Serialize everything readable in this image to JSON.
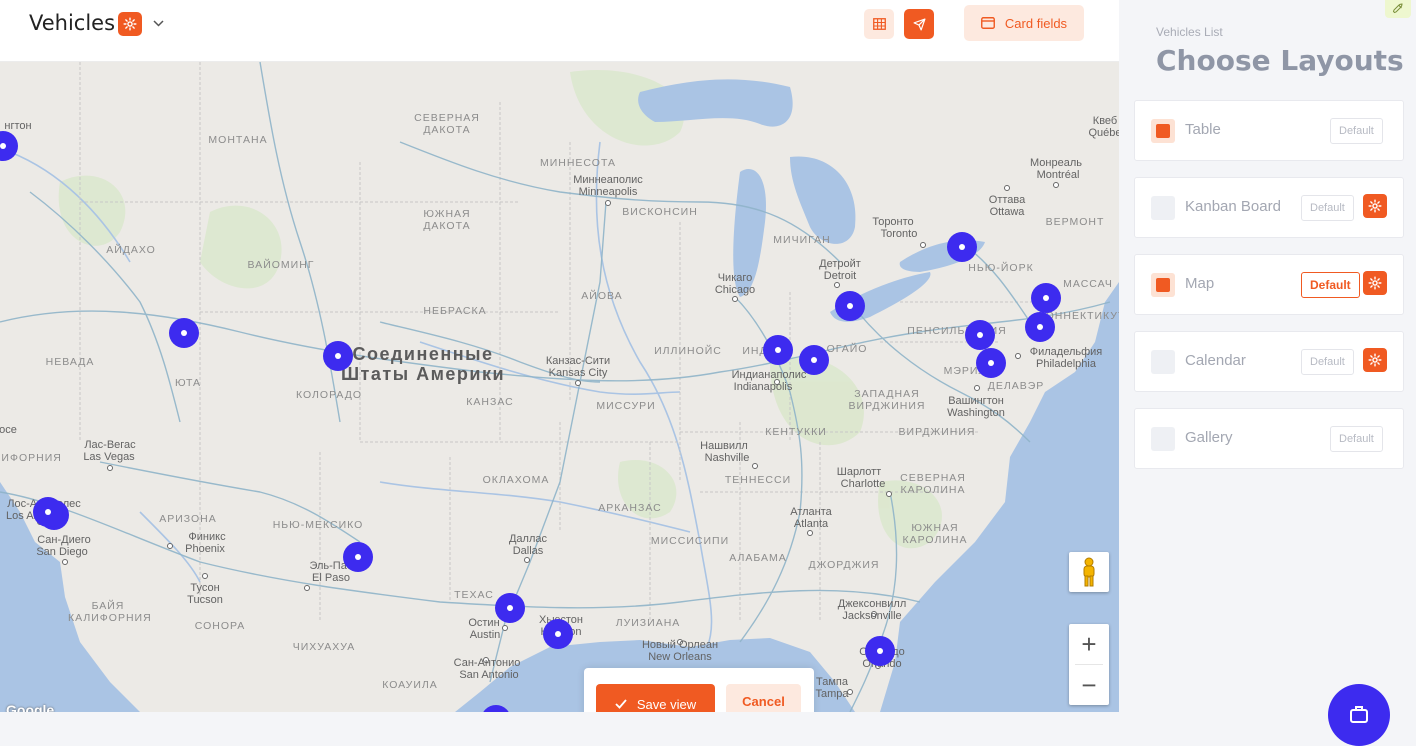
{
  "header": {
    "title": "Vehicles",
    "card_fields_label": "Card fields",
    "icons": [
      "gear-icon",
      "chevron-down-icon",
      "table-icon",
      "send-icon",
      "card-icon"
    ]
  },
  "colors": {
    "accent": "#f05a22",
    "accent_light": "#fde9df",
    "marker": "#3d2bef"
  },
  "map": {
    "country_label": [
      "Соединенные",
      "Штаты Америки"
    ],
    "state_labels": [
      "МОНТАНА",
      "СЕВЕРНАЯ ДАКОТА",
      "ЮЖНАЯ ДАКОТА",
      "АЙДАХО",
      "ВАЙОМИНГ",
      "НЕБРАСКА",
      "НЕВАДА",
      "ЮТА",
      "КОЛОРАДО",
      "КАНЗАС",
      "МИССУРИ",
      "АЙОВА",
      "ИЛЛИНОЙС",
      "ИНД",
      "ОГАЙО",
      "МИННЕСОТА",
      "ВИСКОНСИН",
      "МИЧИГАН",
      "ОКЛАХОМА",
      "АРИЗОНА",
      "НЬЮ-МЕКСИКО",
      "ТЕХАС",
      "АРКАНЗАС",
      "ТЕННЕССИ",
      "КЕНТУККИ",
      "МИССИСИПИ",
      "АЛАБАМА",
      "ДЖОРДЖИЯ",
      "ЮЖНАЯ КАРОЛИНА",
      "СЕВЕРНАЯ КАРОЛИНА",
      "ВИРДЖИНИЯ",
      "ЗАПАДНАЯ ВИРДЖИНИЯ",
      "ПЕНСИЛЬВАНИЯ",
      "НЬЮ-ЙОРК",
      "ВЕРМОНТ",
      "МАССАЧ",
      "КОННЕКТИКУТ",
      "ДЕЛАВЭР",
      "МЭРИЛ",
      "ЛУИЗИАНА",
      "СОНОРА",
      "ЧИХУАХУА",
      "КОАУИЛА",
      "БАЙЯ КАЛИФОРНИЯ",
      "КАЛИФОРНИЯ"
    ],
    "city_labels": [
      "Миннеаполис",
      "Minneapolis",
      "Торонто",
      "Toronto",
      "Оттава",
      "Ottawa",
      "Монреаль",
      "Montréal",
      "Квеб",
      "Québe",
      "Детройт",
      "Detroit",
      "Чикаго",
      "Chicago",
      "Канзас-Сити",
      "Kansas City",
      "Индианаполис",
      "Indianapolis",
      "Филадельфия",
      "Philadelphia",
      "Вашингтон",
      "Washington",
      "Нашвилл",
      "Nashville",
      "Шарлотт",
      "Charlotte",
      "Атланта",
      "Atlanta",
      "Даллас",
      "Dallas",
      "Остин",
      "Austin",
      "Хьюстон",
      "Houston",
      "Сан-Антонио",
      "San Antonio",
      "Эль-Пасо",
      "El Paso",
      "Финикс",
      "Phoenix",
      "Тусон",
      "Tucson",
      "Лас-Вегас",
      "Las Vegas",
      "Лос-Анджелес",
      "Los Angeles",
      "Сан-Диего",
      "San Diego",
      "Новый Орлеан",
      "New Orleans",
      "Джексонвилл",
      "Jacksonville",
      "Орландо",
      "Orlando",
      "Тампа",
      "Tampa",
      "нгтон",
      "осе",
      "ифорния"
    ],
    "google_label": "Google",
    "controls": [
      "pegman-icon",
      "zoom-in-icon",
      "zoom-out-icon"
    ],
    "zoom_in": "+",
    "zoom_out": "−",
    "marker_count": 18
  },
  "save_bar": {
    "save_label": "Save view",
    "cancel_label": "Cancel"
  },
  "sidebar": {
    "subtitle": "Vehicles List",
    "title": "Choose Layouts",
    "layouts": [
      {
        "name": "Table",
        "default_label": "Default",
        "checked": true,
        "is_default": false,
        "has_settings": false
      },
      {
        "name": "Kanban Board",
        "default_label": "Default",
        "checked": false,
        "is_default": false,
        "has_settings": true
      },
      {
        "name": "Map",
        "default_label": "Default",
        "checked": true,
        "is_default": true,
        "has_settings": true
      },
      {
        "name": "Calendar",
        "default_label": "Default",
        "checked": false,
        "is_default": false,
        "has_settings": true
      },
      {
        "name": "Gallery",
        "default_label": "Default",
        "checked": false,
        "is_default": false,
        "has_settings": false
      }
    ]
  }
}
